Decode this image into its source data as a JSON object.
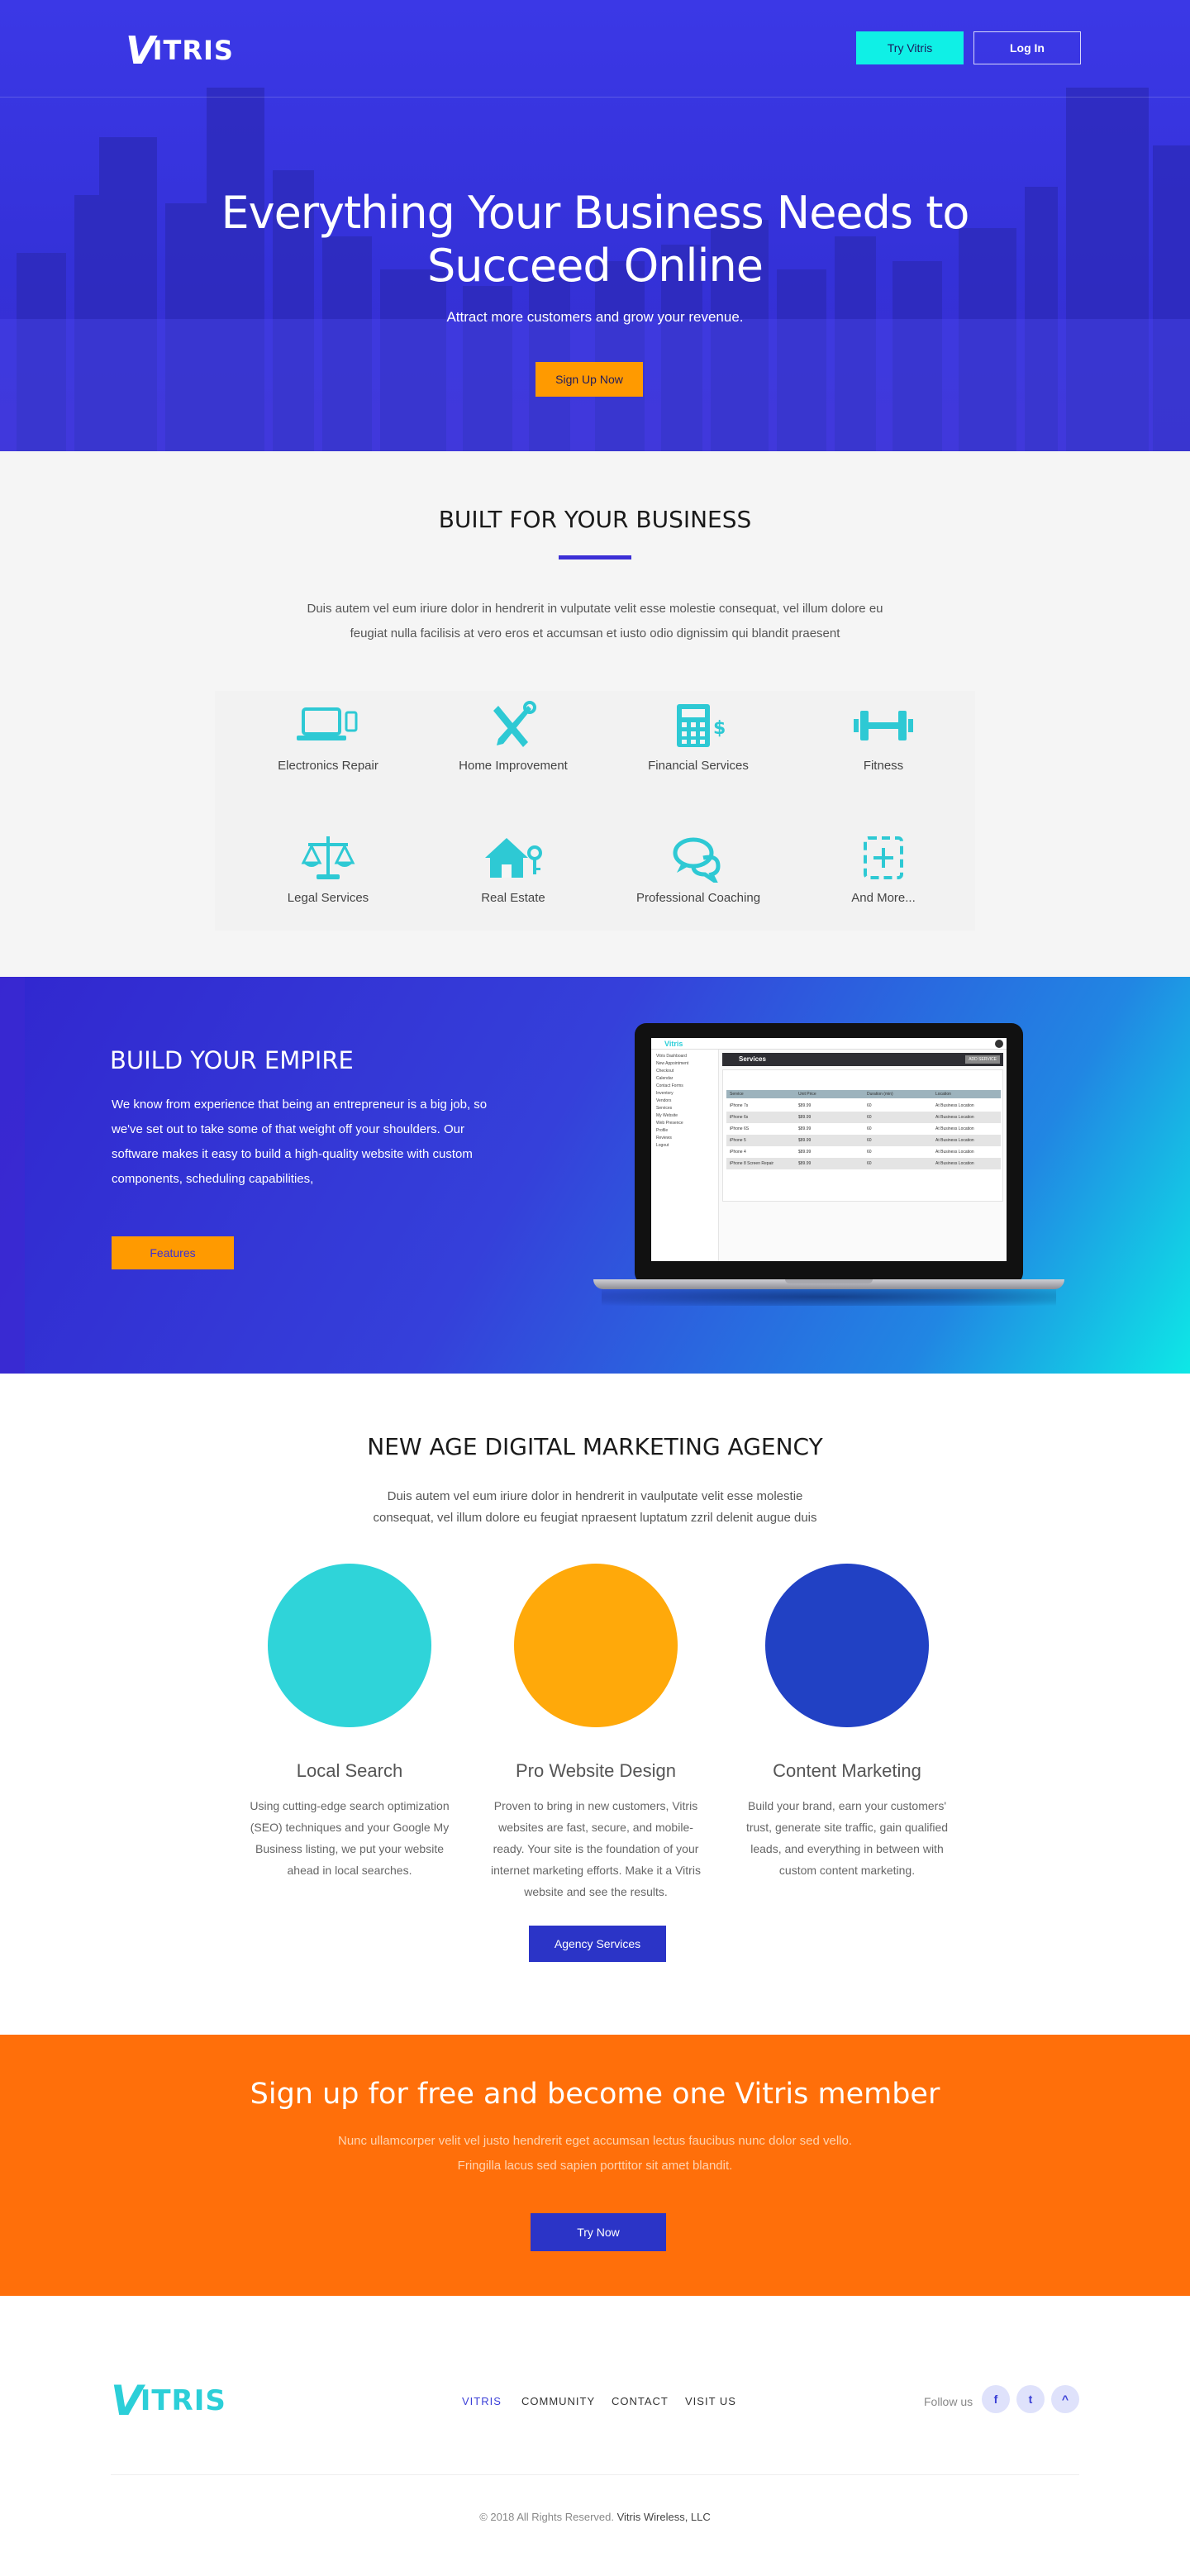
{
  "header": {
    "logo_text": "ITRIS",
    "logo_v": "V",
    "try_label": "Try Vitris",
    "login_label": "Log In"
  },
  "hero": {
    "title": "Everything Your Business Needs to Succeed Online",
    "subtitle": "Attract more customers and grow your revenue.",
    "cta_label": "Sign Up Now"
  },
  "built": {
    "title": "BUILT FOR YOUR BUSINESS",
    "text_line1": "Duis autem vel eum iriure dolor in hendrerit in vulputate velit esse molestie consequat, vel illum dolore eu",
    "text_line2": "feugiat nulla facilisis at vero eros et accumsan et iusto odio dignissim qui blandit praesent",
    "categories": [
      {
        "label": "Electronics Repair",
        "icon": "laptop-phone-icon"
      },
      {
        "label": "Home Improvement",
        "icon": "tools-icon"
      },
      {
        "label": "Financial Services",
        "icon": "calculator-dollar-icon"
      },
      {
        "label": "Fitness",
        "icon": "dumbbell-icon"
      },
      {
        "label": "Legal Services",
        "icon": "scales-icon"
      },
      {
        "label": "Real Estate",
        "icon": "house-key-icon"
      },
      {
        "label": "Professional Coaching",
        "icon": "chat-bubbles-icon"
      },
      {
        "label": "And More...",
        "icon": "plus-square-icon"
      }
    ]
  },
  "empire": {
    "title": "BUILD YOUR EMPIRE",
    "text": "We know from experience that being an entrepreneur is a big job, so we've set out to take some of that weight off your shoulders. Our software makes it easy to build a high-quality website with custom components, scheduling capabilities,",
    "button_label": "Features",
    "screen": {
      "logo": "Vitris",
      "page_title": "Services",
      "add_button": "ADD SERVICE",
      "sidebar_items": [
        "Vitris Dashboard",
        "New Appointment",
        "Checkout",
        "Calendar",
        "Contact Forms",
        "Inventory",
        "Vendors",
        "Services",
        "My Website",
        "Web Presence",
        "Profile",
        "Reviews",
        "Logout"
      ],
      "columns": [
        "Service",
        "Unit Price",
        "Duration (min)",
        "Location"
      ],
      "rows": [
        [
          "iPhone 7s",
          "$89.99",
          "60",
          "At Business Location"
        ],
        [
          "iPhone 6s",
          "$89.99",
          "60",
          "At Business Location"
        ],
        [
          "iPhone 6S",
          "$89.99",
          "60",
          "At Business Location"
        ],
        [
          "iPhone 5",
          "$89.99",
          "60",
          "At Business Location"
        ],
        [
          "iPhone 4",
          "$89.99",
          "60",
          "At Business Location"
        ],
        [
          "iPhone 8 Screen Repair",
          "$89.99",
          "60",
          "At Business Location"
        ]
      ]
    }
  },
  "agency": {
    "title": "NEW AGE DIGITAL MARKETING AGENCY",
    "text_line1": "Duis autem vel eum iriure dolor in hendrerit in vaulputate velit esse molestie",
    "text_line2": "consequat, vel illum dolore eu feugiat npraesent luptatum zzril delenit augue duis",
    "services": [
      {
        "title": "Local Search",
        "color": "#2fd4d9",
        "desc": "Using cutting-edge search optimization (SEO) techniques and your Google My Business listing, we put your website ahead in local searches."
      },
      {
        "title": "Pro Website Design",
        "color": "#ffa90a",
        "desc": "Proven to bring in new customers, Vitris websites are fast, secure, and mobile-ready. Your site is the foundation of your internet marketing efforts. Make it a Vitris website and see the results."
      },
      {
        "title": "Content Marketing",
        "color": "#2141c4",
        "desc": "Build your brand, earn your customers' trust, generate site traffic, gain qualified leads, and everything in between with custom content marketing."
      }
    ],
    "button_label": "Agency Services"
  },
  "cta": {
    "title": "Sign up for free and become one Vitris member",
    "text_line1": "Nunc ullamcorper velit vel justo hendrerit eget accumsan lectus faucibus nunc dolor sed vello.",
    "text_line2": "Fringilla lacus sed sapien porttitor sit amet blandit.",
    "button_label": "Try Now"
  },
  "footer": {
    "logo_text": "ITRIS",
    "logo_v": "V",
    "nav": [
      "VITRIS",
      "COMMUNITY",
      "CONTACT",
      "VISIT US"
    ],
    "follow_label": "Follow us",
    "social": [
      "f",
      "t",
      "^"
    ],
    "copyright": "© 2018 All Rights Reserved.",
    "company": "Vitris Wireless, LLC"
  },
  "colors": {
    "primary": "#3b38e6",
    "accent_cyan": "#0ff0e6",
    "accent_orange": "#ff9a00",
    "icon_teal": "#2ec9d4",
    "cta_orange": "#ff6f0a",
    "button_blue": "#2b34c7"
  }
}
